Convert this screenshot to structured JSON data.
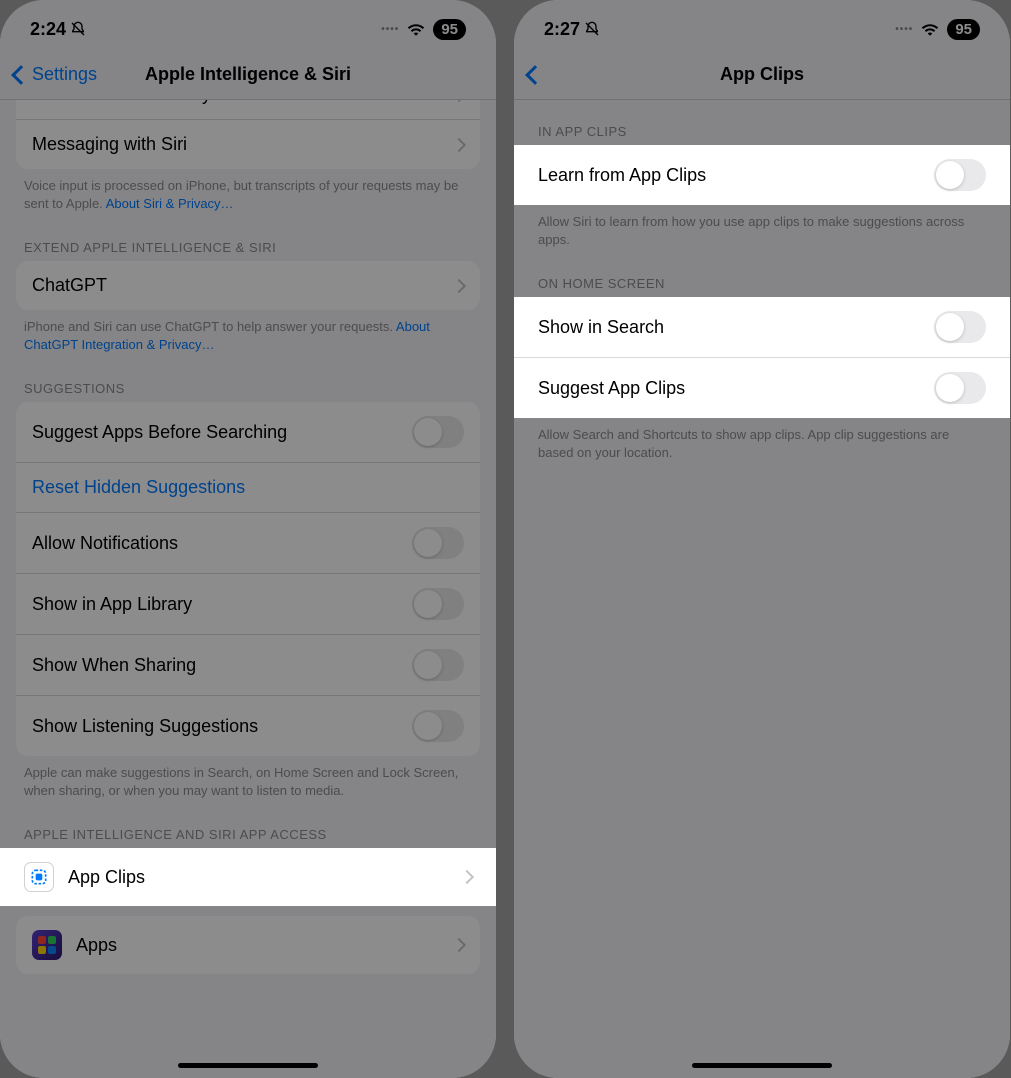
{
  "left": {
    "status": {
      "time": "2:24",
      "battery": "95"
    },
    "nav": {
      "back": "Settings",
      "title": "Apple Intelligence & Siri"
    },
    "rows": {
      "siri_history": "Siri & Dictation History",
      "messaging": "Messaging with Siri"
    },
    "footer1": {
      "text": "Voice input is processed on iPhone, but transcripts of your requests may be sent to Apple. ",
      "link": "About Siri & Privacy…"
    },
    "section_extend": "EXTEND APPLE INTELLIGENCE & SIRI",
    "chatgpt": "ChatGPT",
    "footer2": {
      "text": "iPhone and Siri can use ChatGPT to help answer your requests. ",
      "link": "About ChatGPT Integration & Privacy…"
    },
    "section_suggestions": "SUGGESTIONS",
    "suggestions": {
      "suggest_before": "Suggest Apps Before Searching",
      "reset_hidden": "Reset Hidden Suggestions",
      "allow_notifications": "Allow Notifications",
      "show_app_library": "Show in App Library",
      "show_when_sharing": "Show When Sharing",
      "show_listening": "Show Listening Suggestions"
    },
    "footer3": "Apple can make suggestions in Search, on Home Screen and Lock Screen, when sharing, or when you may want to listen to media.",
    "section_access": "APPLE INTELLIGENCE AND SIRI APP ACCESS",
    "app_clips": "App Clips",
    "apps": "Apps"
  },
  "right": {
    "status": {
      "time": "2:27",
      "battery": "95"
    },
    "nav": {
      "title": "App Clips"
    },
    "section_in": "IN APP CLIPS",
    "learn": "Learn from App Clips",
    "footer_learn": "Allow Siri to learn from how you use app clips to make suggestions across apps.",
    "section_home": "ON HOME SCREEN",
    "show_search": "Show in Search",
    "suggest_clips": "Suggest App Clips",
    "footer_home": "Allow Search and Shortcuts to show app clips. App clip suggestions are based on your location."
  }
}
